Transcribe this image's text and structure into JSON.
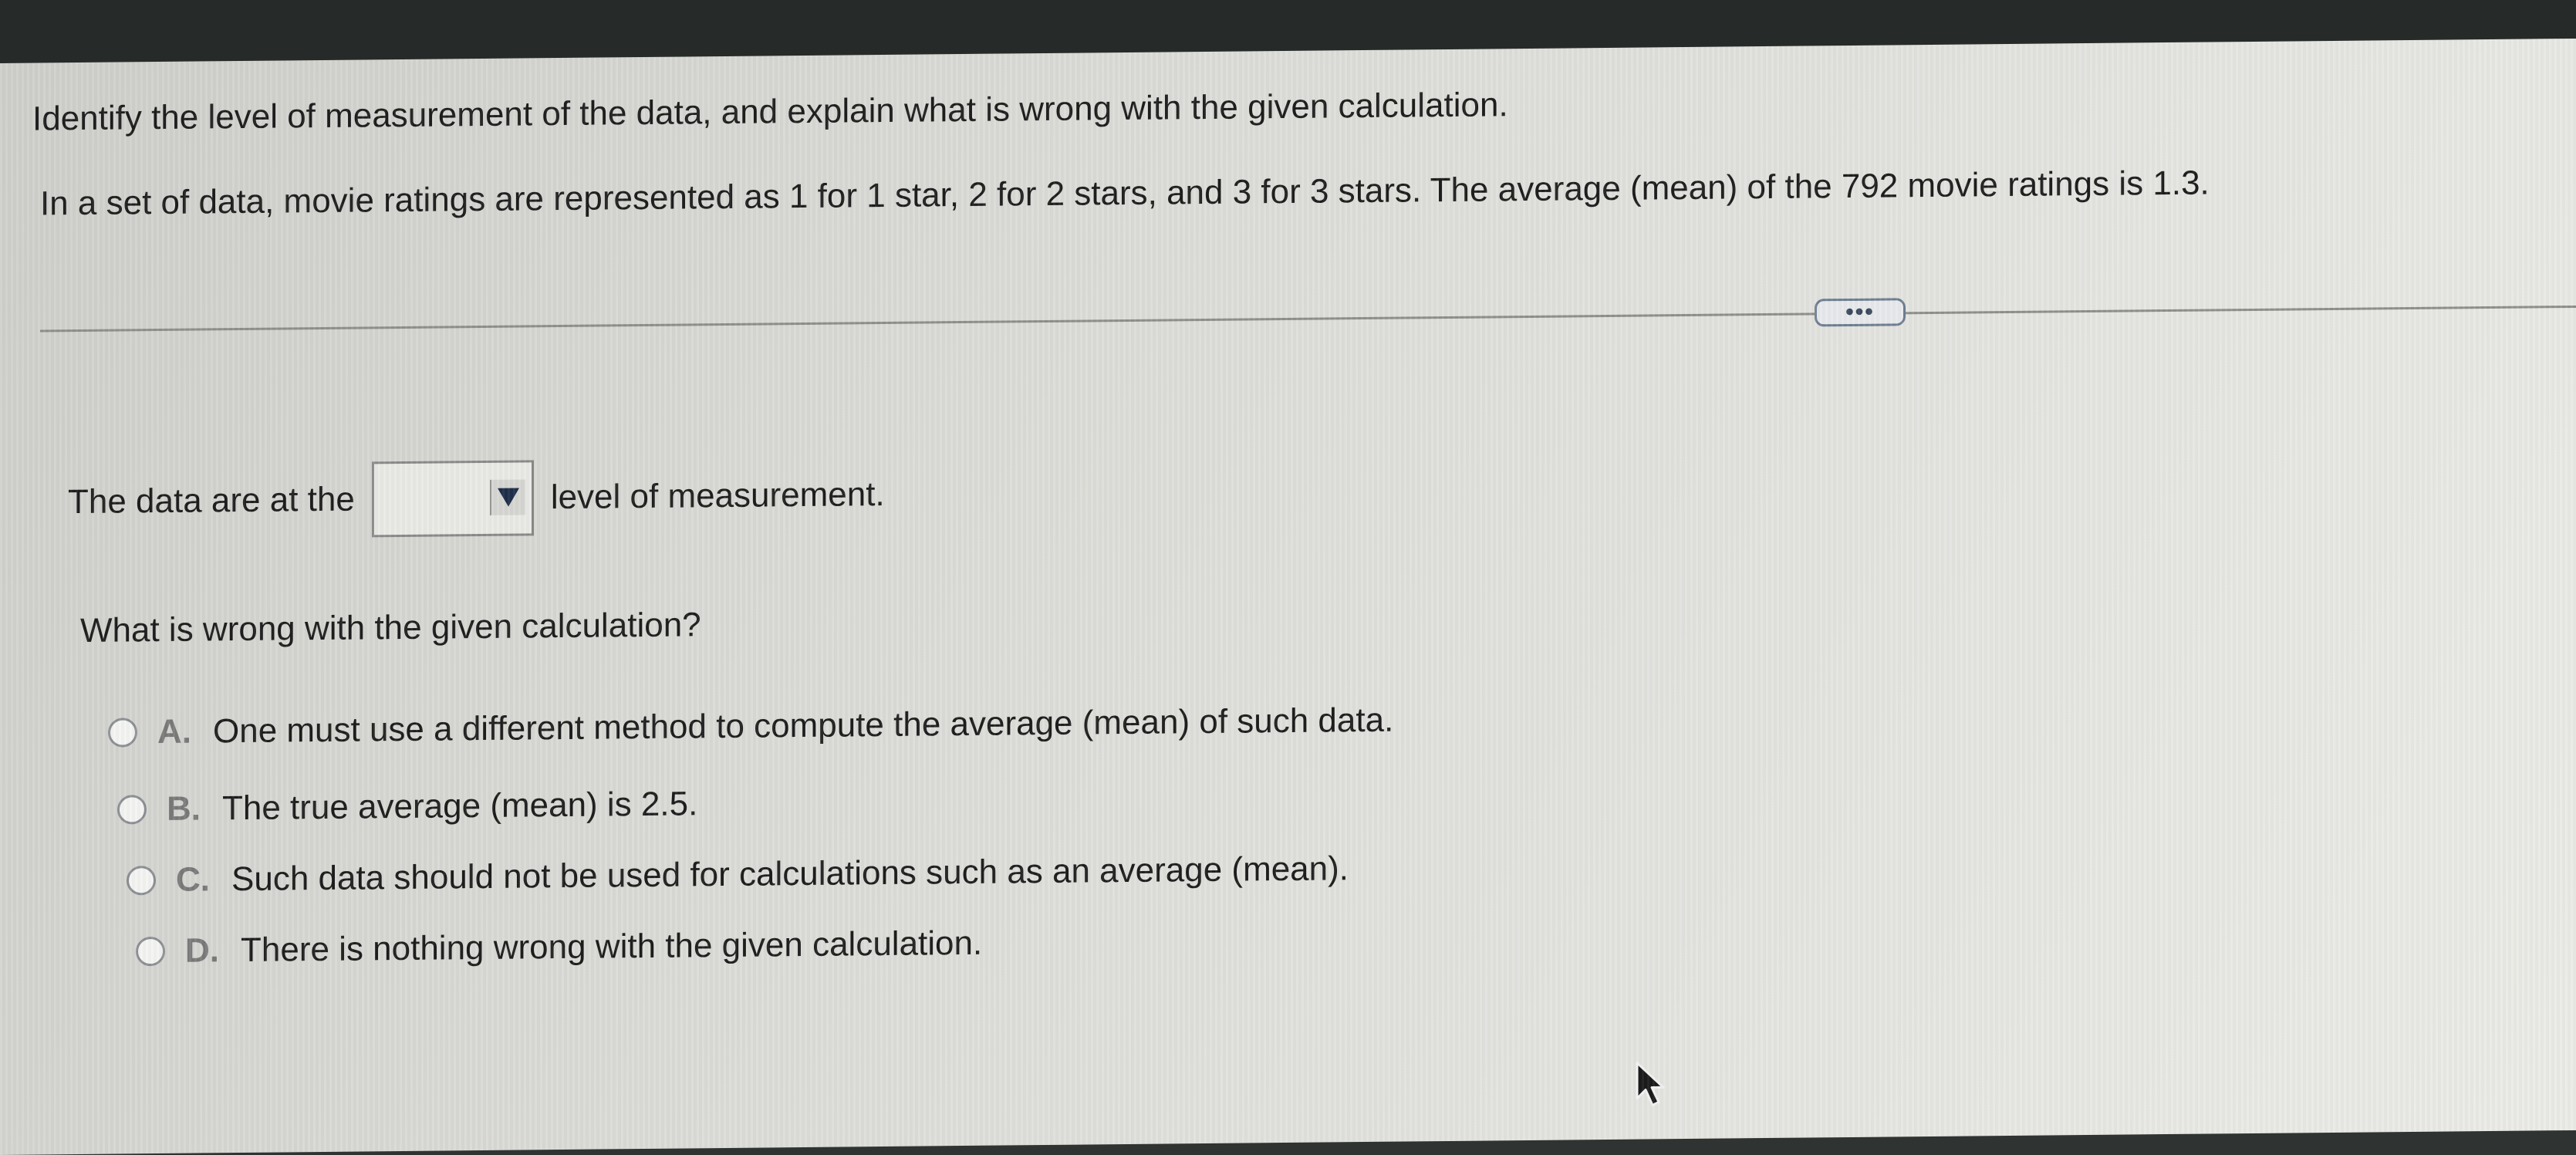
{
  "question": {
    "title": "Identify the level of measurement of the data, and explain what is wrong with the given calculation.",
    "body": "In a set of data, movie ratings are represented as 1 for 1 star, 2 for 2 stars, and 3 for 3 stars. The average (mean) of the 792 movie ratings is 1.3."
  },
  "more_button": {
    "label": "•••"
  },
  "fill_in": {
    "prefix": "The data are at the",
    "selected_value": "",
    "suffix": "level of measurement."
  },
  "sub_question": "What is wrong with the given calculation?",
  "options": [
    {
      "letter": "A.",
      "text": "One must use a different method to compute the average (mean) of such data."
    },
    {
      "letter": "B.",
      "text": "The true average (mean) is 2.5."
    },
    {
      "letter": "C.",
      "text": "Such data should not be used for calculations such as an average (mean)."
    },
    {
      "letter": "D.",
      "text": "There is nothing wrong with the given calculation."
    }
  ],
  "icons": {
    "dropdown": "triangle-down-icon",
    "cursor": "mouse-pointer-icon"
  }
}
